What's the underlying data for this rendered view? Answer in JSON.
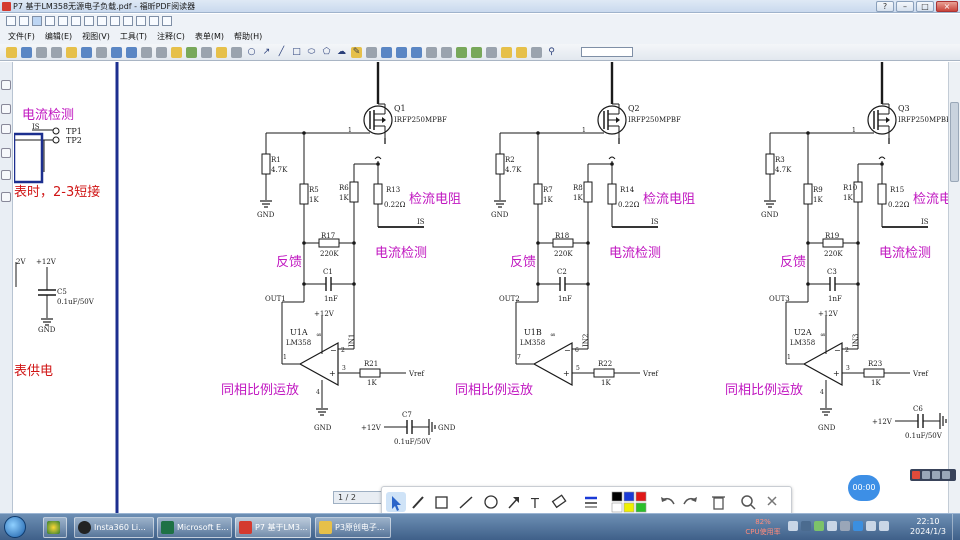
{
  "window": {
    "title": "P7 基于LM358无源电子负载.pdf - 福昕PDF阅读器",
    "buttons": [
      "?",
      "–",
      "□",
      "×"
    ]
  },
  "menu": {
    "items": [
      "文件(F)",
      "编辑(E)",
      "视图(V)",
      "工具(T)",
      "注释(C)",
      "表单(M)",
      "帮助(H)"
    ]
  },
  "left_panel": {
    "heading": "电流检测",
    "net_is": "IS",
    "tp1": "TP1",
    "tp2": "TP2",
    "short_note": "表时，2-3短接",
    "v12a": "2V",
    "v12b": "+12V",
    "c5": "C5",
    "c5_val": "0.1uF/50V",
    "gnd": "GND",
    "supply_note": "表供电"
  },
  "circuits": [
    {
      "q": "Q1",
      "q_part": "IRFP250MPBF",
      "r_gate": "R1",
      "r_gate_val": "4.7K",
      "r_a": "R5",
      "r_a_val": "1K",
      "r_b": "R6",
      "r_b_val": "1K",
      "r_sense": "R13",
      "r_sense_val": "0.22Ω",
      "r_fb": "R17",
      "r_fb_val": "220K",
      "cap": "C1",
      "cap_val": "1nF",
      "out": "OUT1",
      "in_net": "IN1",
      "op": "U1A",
      "op_part": "LM358",
      "r_in": "R21",
      "r_in_val": "1K",
      "pin_out": "1",
      "pin_neg": "2",
      "pin_pos": "3",
      "show_power_pins": true,
      "vref": "Vref",
      "gnd": "GND",
      "vcc": "+12V",
      "label_sense_res": "检流电阻",
      "label_sense": "电流检测",
      "label_fb": "反馈",
      "label_amp": "同相比例运放",
      "net_is": "IS",
      "pin1": "1"
    },
    {
      "q": "Q2",
      "q_part": "IRFP250MPBF",
      "r_gate": "R2",
      "r_gate_val": "4.7K",
      "r_a": "R7",
      "r_a_val": "1K",
      "r_b": "R8",
      "r_b_val": "1K",
      "r_sense": "R14",
      "r_sense_val": "0.22Ω",
      "r_fb": "R18",
      "r_fb_val": "220K",
      "cap": "C2",
      "cap_val": "1nF",
      "out": "OUT2",
      "in_net": "IN2",
      "op": "U1B",
      "op_part": "LM358",
      "r_in": "R22",
      "r_in_val": "1K",
      "pin_out": "7",
      "pin_neg": "6",
      "pin_pos": "5",
      "show_power_pins": false,
      "vref": "Vref",
      "gnd": "GND",
      "vcc": "",
      "label_sense_res": "检流电阻",
      "label_sense": "电流检测",
      "label_fb": "反馈",
      "label_amp": "同相比例运放",
      "net_is": "IS",
      "pin1": "1"
    },
    {
      "q": "Q3",
      "q_part": "IRFP250MPBF",
      "r_gate": "R3",
      "r_gate_val": "4.7K",
      "r_a": "R9",
      "r_a_val": "1K",
      "r_b": "R10",
      "r_b_val": "1K",
      "r_sense": "R15",
      "r_sense_val": "0.22Ω",
      "r_fb": "R19",
      "r_fb_val": "220K",
      "cap": "C3",
      "cap_val": "1nF",
      "out": "OUT3",
      "in_net": "IN3",
      "op": "U2A",
      "op_part": "LM358",
      "r_in": "R23",
      "r_in_val": "1K",
      "pin_out": "1",
      "pin_neg": "2",
      "pin_pos": "3",
      "show_power_pins": true,
      "vref": "Vref",
      "gnd": "GND",
      "vcc": "+12V",
      "label_sense_res": "检流电",
      "label_sense": "电流检测",
      "label_fb": "反馈",
      "label_amp": "同相比例运放",
      "net_is": "IS",
      "pin1": "1"
    }
  ],
  "decoupling": [
    {
      "cap": "C7",
      "val": "0.1uF/50V",
      "vcc": "+12V",
      "gnd": "GND"
    },
    {
      "cap": "C6",
      "val": "0.1uF/50V",
      "vcc": "+12V",
      "gnd": ""
    }
  ],
  "page_indicator": "1 / 2",
  "timer": "00:00",
  "annotation_toolbar": {
    "tools": [
      "select-arrow",
      "pen",
      "rectangle",
      "line",
      "circle",
      "arrow",
      "text",
      "eraser",
      "line-width",
      "color-palette",
      "undo",
      "redo",
      "delete",
      "search",
      "close"
    ],
    "colors": [
      "#000000",
      "#1a3ad6",
      "#e01818",
      "#ffffff",
      "#f0f000",
      "#2bbf2b"
    ]
  },
  "taskbar": {
    "apps": [
      "Insta360 Li...",
      "Microsoft E...",
      "P7 基于LM3...",
      "P3原创电子..."
    ],
    "cpu_percent": "82%",
    "cpu_label": "CPU使用率",
    "time": "22:10",
    "date": "2024/1/3"
  },
  "colors": {
    "wire": "#1a1a1a",
    "label_magenta": "#c016c0",
    "label_red": "#d01515",
    "rail_blue": "#1c2f8f"
  }
}
